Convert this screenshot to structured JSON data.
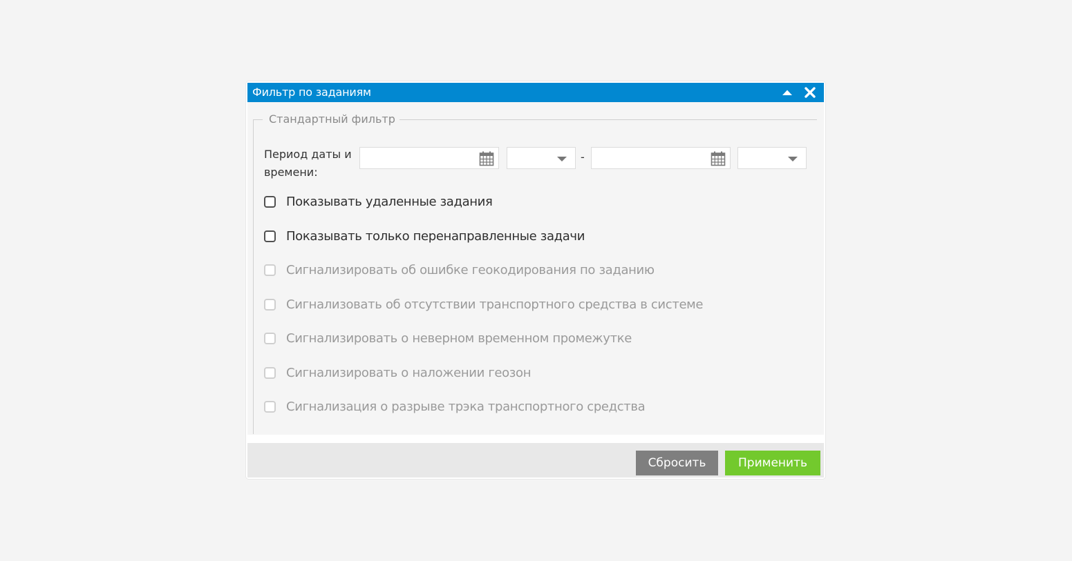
{
  "dialog": {
    "title": "Фильтр по заданиям",
    "header_color": "#0288d1",
    "collapse_icon": "triangle-up-icon",
    "close_icon": "close-icon"
  },
  "filter": {
    "legend": "Стандартный фильтр",
    "period_label": "Период даты и времени:",
    "period_separator": "-",
    "start_date": {
      "value": "",
      "icon": "calendar-icon"
    },
    "start_time": {
      "value": "",
      "icon": "chevron-down-icon"
    },
    "end_date": {
      "value": "",
      "icon": "calendar-icon"
    },
    "end_time": {
      "value": "",
      "icon": "chevron-down-icon"
    },
    "options": [
      {
        "label": "Показывать удаленные задания",
        "checked": false,
        "enabled": true
      },
      {
        "label": "Показывать только перенаправленные задачи",
        "checked": false,
        "enabled": true
      },
      {
        "label": "Сигнализировать об ошибке геокодирования по заданию",
        "checked": false,
        "enabled": false
      },
      {
        "label": "Сигнализовать об отсутствии транспортного средства в системе",
        "checked": false,
        "enabled": false
      },
      {
        "label": "Сигнализировать о неверном временном промежутке",
        "checked": false,
        "enabled": false
      },
      {
        "label": "Сигнализировать о наложении геозон",
        "checked": false,
        "enabled": false
      },
      {
        "label": "Сигнализация о разрыве трэка транспортного средства",
        "checked": false,
        "enabled": false
      }
    ]
  },
  "footer": {
    "reset_label": "Сбросить",
    "apply_label": "Применить",
    "reset_color": "#7f7f7f",
    "apply_color": "#73c92d"
  }
}
